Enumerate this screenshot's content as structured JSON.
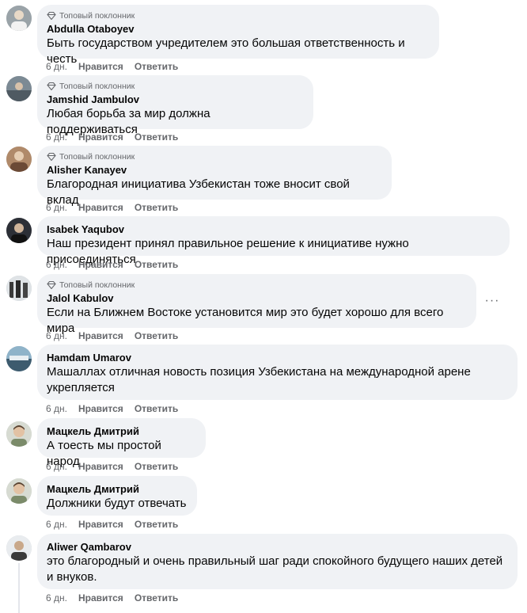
{
  "badge_label": "Топовый поклонник",
  "actions": {
    "time": "6 дн.",
    "like": "Нравится",
    "reply": "Ответить"
  },
  "more_label": "···",
  "comments": [
    {
      "author": "Abdulla Otaboyev",
      "top_fan": true,
      "text": "Быть государством учредителем это большая ответственность и честь"
    },
    {
      "author": "Jamshid Jambulov",
      "top_fan": true,
      "text": "Любая борьба за мир должна поддерживаться"
    },
    {
      "author": "Alisher Kanayev",
      "top_fan": true,
      "text": "Благородная инициатива Узбекистан тоже вносит свой вклад"
    },
    {
      "author": "Isabek Yaqubov",
      "top_fan": false,
      "text": "Наш президент принял правильное решение к инициативе нужно присоединяться"
    },
    {
      "author": "Jalol Kabulov",
      "top_fan": true,
      "text": "Если на Ближнем Востоке установится мир это будет хорошо для всего мира"
    },
    {
      "author": "Hamdam Umarov",
      "top_fan": false,
      "text_line1": "Машаллах отличная новость позиция Узбекистана на международной арене",
      "text_line2": "укрепляется"
    },
    {
      "author": "Мацкель Дмитрий",
      "top_fan": false,
      "text": "А тоесть мы простой народ"
    },
    {
      "author": "Мацкель Дмитрий",
      "top_fan": false,
      "text": "Должники будут отвечать"
    },
    {
      "author": "Aliwer Qambarov",
      "top_fan": false,
      "text_line1": "это благородный и очень правильный шаг ради спокойного будущего наших детей",
      "text_line2": "и внуков."
    }
  ]
}
